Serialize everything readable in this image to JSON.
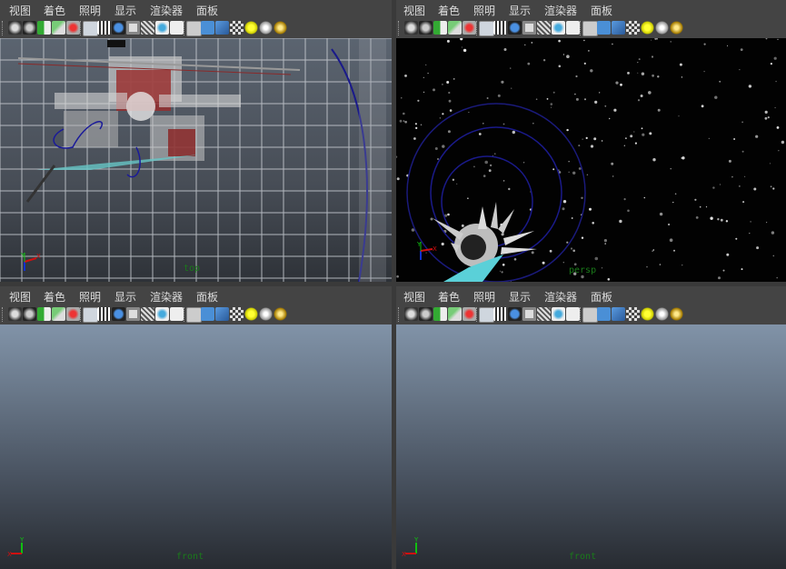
{
  "menu": [
    "视图",
    "着色",
    "照明",
    "显示",
    "渲染器",
    "面板"
  ],
  "toolbar_icons": [
    "camera-icon",
    "camera-attributes-icon",
    "bookmark-icon",
    "image-plane-icon",
    "grid-snap-icon",
    "wireframe-icon",
    "film-gate-icon",
    "resolution-gate-icon",
    "safe-action-icon",
    "field-chart-icon",
    "safe-title-icon",
    "text-icon",
    "wireframe-shading-icon",
    "smooth-shading-icon",
    "wireframe-on-shaded-icon",
    "texture-icon",
    "default-lighting-icon",
    "all-lights-icon",
    "shadows-icon"
  ],
  "panels": {
    "top_left": {
      "camera": "top",
      "axis": {
        "y": "Y",
        "x": "X"
      }
    },
    "top_right": {
      "camera": "persp",
      "axis": {
        "y": "Y",
        "x": "X"
      }
    },
    "bottom_left": {
      "camera": "front",
      "axis": {
        "y": "Y",
        "x": "X"
      }
    },
    "bottom_right": {
      "camera": "front",
      "axis": {
        "y": "Y",
        "x": "X"
      }
    }
  },
  "colors": {
    "ui_bg": "#444444",
    "menu_text": "#dcdcdc",
    "camera_label": "#1a7a1a",
    "grid_line": "#c8ccd2",
    "axis_x": "#d01010",
    "axis_y": "#10c010",
    "axis_z": "#1030d0"
  }
}
